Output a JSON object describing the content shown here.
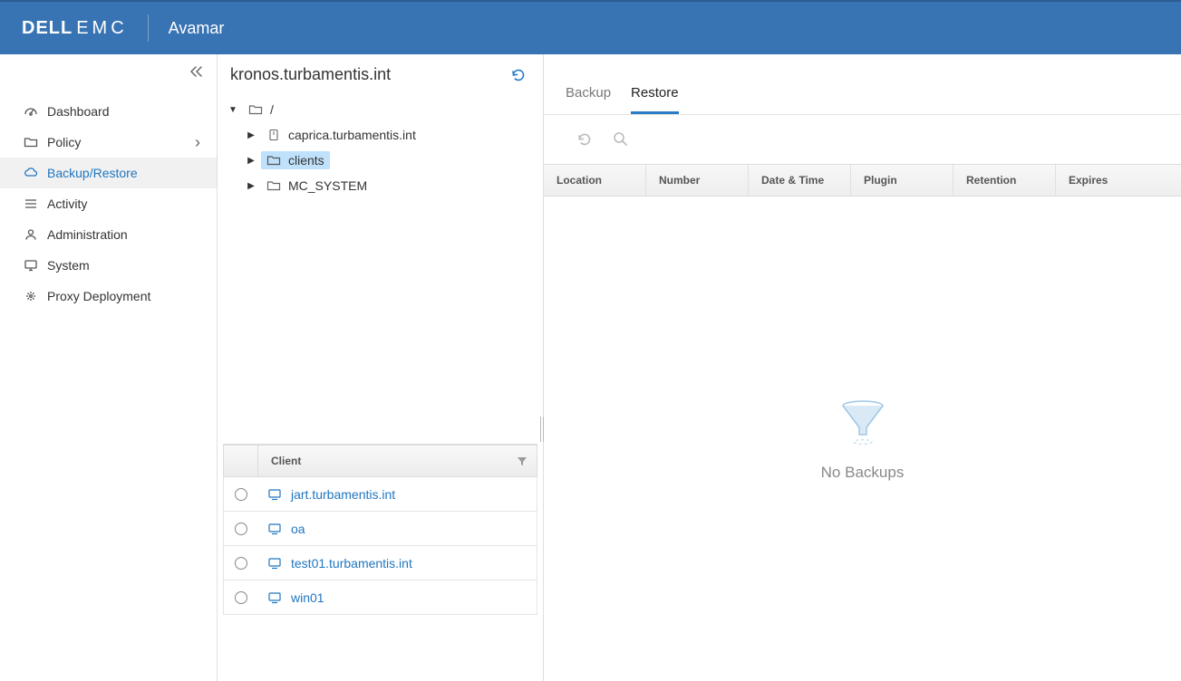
{
  "header": {
    "brand_primary": "DELL",
    "brand_secondary": "EMC",
    "app_name": "Avamar"
  },
  "sidebar": {
    "items": [
      {
        "label": "Dashboard"
      },
      {
        "label": "Policy"
      },
      {
        "label": "Backup/Restore"
      },
      {
        "label": "Activity"
      },
      {
        "label": "Administration"
      },
      {
        "label": "System"
      },
      {
        "label": "Proxy Deployment"
      }
    ]
  },
  "middle": {
    "title": "kronos.turbamentis.int",
    "tree": {
      "root_label": "/",
      "children": [
        {
          "label": "caprica.turbamentis.int"
        },
        {
          "label": "clients"
        },
        {
          "label": "MC_SYSTEM"
        }
      ]
    },
    "client_header": "Client",
    "clients": [
      {
        "name": "jart.turbamentis.int"
      },
      {
        "name": "oa"
      },
      {
        "name": "test01.turbamentis.int"
      },
      {
        "name": "win01"
      }
    ]
  },
  "right": {
    "tabs": [
      {
        "label": "Backup"
      },
      {
        "label": "Restore"
      }
    ],
    "columns": [
      "Location",
      "Number",
      "Date & Time",
      "Plugin",
      "Retention",
      "Expires"
    ],
    "empty_text": "No Backups"
  }
}
